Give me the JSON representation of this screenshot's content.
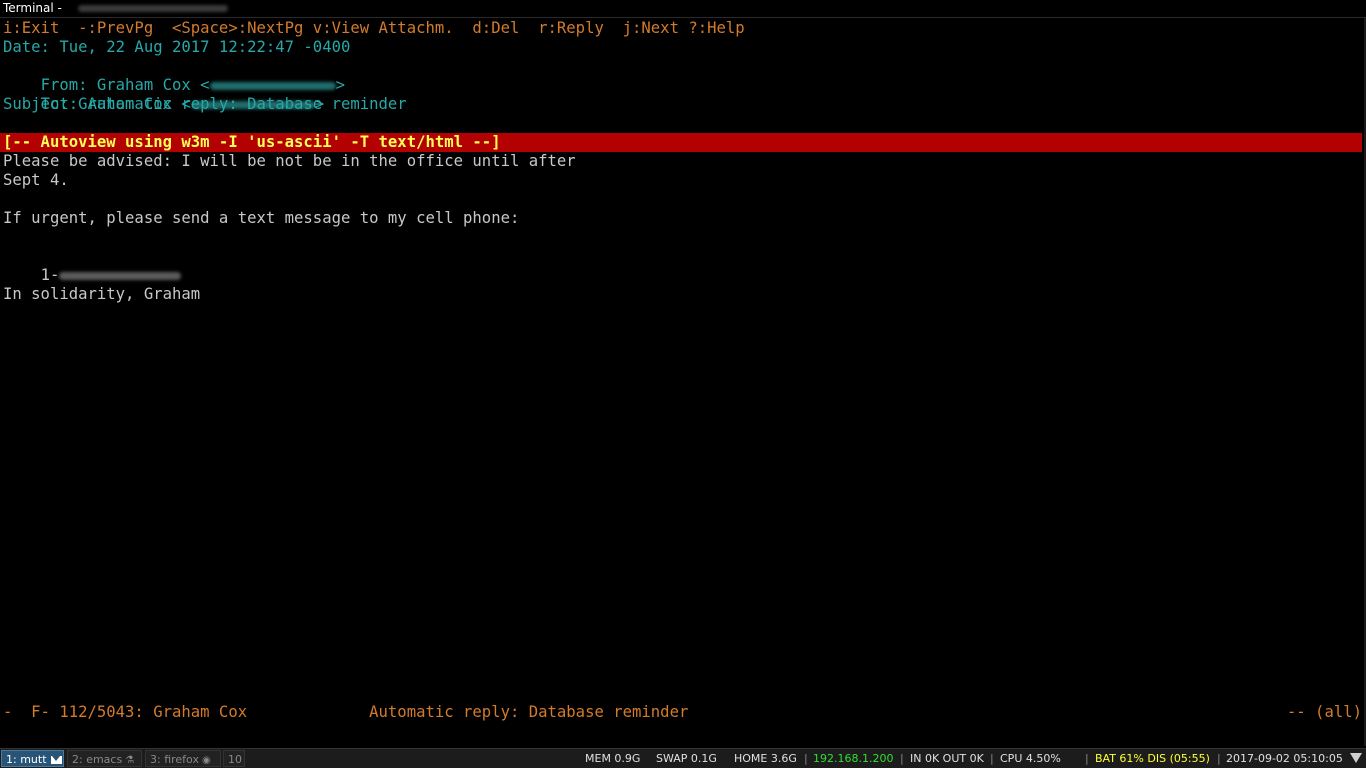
{
  "window": {
    "title": "Terminal - "
  },
  "help_bar": "i:Exit  -:PrevPg  <Space>:NextPg v:View Attachm.  d:Del  r:Reply  j:Next ?:Help",
  "headers": {
    "date": "Date: Tue, 22 Aug 2017 12:22:47 -0400",
    "from_prefix": "From: Graham Cox <",
    "from_suffix": ">",
    "to_prefix": "To: Graham Cox <",
    "to_suffix": ">",
    "subject": "Subject: Automatic reply: Database reminder"
  },
  "autoview_line": "[-- Autoview using w3m -I 'us-ascii' -T text/html --]",
  "body": {
    "line1": "Please be advised: I will be not be in the office until after",
    "line2": "Sept 4.",
    "line3": "If urgent, please send a text message to my cell phone:",
    "phone_prefix": "1-",
    "line5": "In solidarity, Graham"
  },
  "status_line": {
    "left": "-  F- 112/5043: Graham Cox             Automatic reply: Database reminder",
    "right": "-- (all)"
  },
  "taskbar": {
    "workspaces": [
      {
        "label": "1: mutt",
        "icon": "envelope-icon",
        "active": true
      },
      {
        "label": "2: emacs",
        "icon": "flask-icon",
        "active": false
      },
      {
        "label": "3: firefox",
        "icon": "globe-icon",
        "active": false
      },
      {
        "label": "10",
        "icon": "",
        "active": false
      }
    ],
    "mem": "MEM 0.9G",
    "swap": "SWAP 0.1G",
    "home": "HOME 3.6G",
    "ip": "192.168.1.200",
    "net": "IN 0K OUT 0K",
    "cpu": "CPU 4.50%",
    "battery": "BAT 61% DIS (05:55)",
    "datetime": "2017-09-02 05:10:05"
  },
  "colors": {
    "help_orange": "#d27b2c",
    "header_cyan": "#26a8a8",
    "autoview_bg": "#b30000",
    "autoview_fg": "#ffff55",
    "ip_green": "#33dd33",
    "battery_yellow": "#ffff33",
    "workspace_active": "#285577"
  }
}
